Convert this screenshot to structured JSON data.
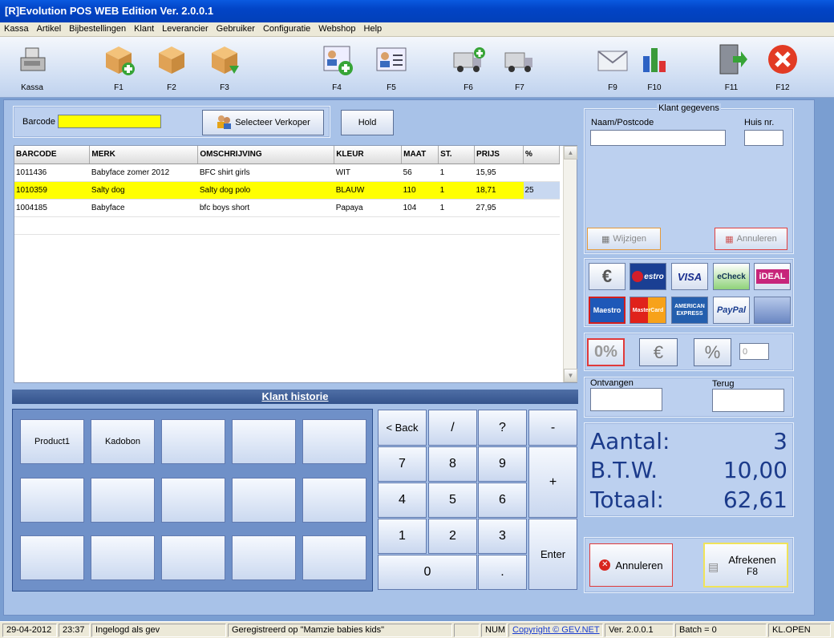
{
  "window": {
    "title": "[R]Evolution POS WEB Edition Ver. 2.0.0.1"
  },
  "menu": [
    "Kassa",
    "Artikel",
    "Bijbestellingen",
    "Klant",
    "Leverancier",
    "Gebruiker",
    "Configuratie",
    "Webshop",
    "Help"
  ],
  "toolbar": {
    "kassa": "Kassa",
    "f1": "F1",
    "f2": "F2",
    "f3": "F3",
    "f4": "F4",
    "f5": "F5",
    "f6": "F6",
    "f7": "F7",
    "f9": "F9",
    "f10": "F10",
    "f11": "F11",
    "f12": "F12"
  },
  "barcode": {
    "label": "Barcode",
    "value": ""
  },
  "buttons": {
    "selecteer_verkoper": "Selecteer Verkoper",
    "hold": "Hold"
  },
  "grid": {
    "columns": [
      "BARCODE",
      "MERK",
      "OMSCHRIJVING",
      "KLEUR",
      "MAAT",
      "ST.",
      "PRIJS",
      "%"
    ],
    "rows": [
      [
        "1011436",
        "Babyface zomer 2012",
        "BFC shirt girls",
        "WIT",
        "56",
        "1",
        "15,95",
        ""
      ],
      [
        "1010359",
        "Salty dog",
        "Salty dog polo",
        "BLAUW",
        "110",
        "1",
        "18,71",
        "25"
      ],
      [
        "1004185",
        "Babyface",
        "bfc boys short",
        "Papaya",
        "104",
        "1",
        "27,95",
        ""
      ]
    ],
    "selected_row": 1
  },
  "klant": {
    "title": "Klant gegevens",
    "naam_label": "Naam/Postcode",
    "huis_label": "Huis nr.",
    "wijzigen": "Wijzigen",
    "annuleren": "Annuleren"
  },
  "payment_methods": {
    "echeck": "eCheck",
    "visa": "VISA",
    "maestro": "Maestro",
    "mastercard": "MasterCard",
    "amex": "AMERICAN EXPRESS",
    "paypal": "PayPal",
    "cirrus": "estro",
    "ideal": "iDEAL"
  },
  "discount": {
    "zero_pct": "0%",
    "euro": "€",
    "pct": "%",
    "value": "0"
  },
  "ontvangen": {
    "label": "Ontvangen",
    "value": ""
  },
  "terug": {
    "label": "Terug",
    "value": ""
  },
  "totals": {
    "aantal_label": "Aantal:",
    "aantal": "3",
    "btw_label": "B.T.W.",
    "btw": "10,00",
    "totaal_label": "Totaal:",
    "totaal": "62,61"
  },
  "actions": {
    "annuleren": "Annuleren",
    "afrekenen": "Afrekenen",
    "afrekenen_key": "F8"
  },
  "historie": {
    "title": "Klant historie",
    "tiles": [
      "Product1",
      "Kadobon",
      "",
      "",
      "",
      "",
      "",
      "",
      "",
      "",
      "",
      "",
      "",
      "",
      ""
    ]
  },
  "keypad": {
    "back": "< Back",
    "slash": "/",
    "question": "?",
    "minus": "-",
    "k7": "7",
    "k8": "8",
    "k9": "9",
    "plus": "+",
    "k4": "4",
    "k5": "5",
    "k6": "6",
    "k1": "1",
    "k2": "2",
    "k3": "3",
    "enter": "Enter",
    "k0": "0",
    "dot": "."
  },
  "status": {
    "date": "29-04-2012",
    "time": "23:37",
    "user": "Ingelogd als gev",
    "registered": "Geregistreerd op \"Mamzie babies kids\"",
    "num": "NUM",
    "copyright": "Copyright © GEV.NET",
    "version": "Ver. 2.0.0.1",
    "batch": "Batch = 0",
    "klopen": "KL.OPEN"
  }
}
